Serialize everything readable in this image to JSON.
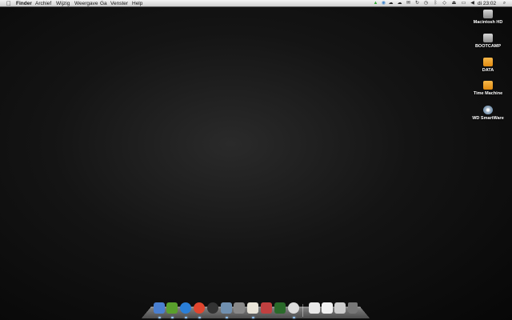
{
  "menubar": {
    "items": [
      "Finder",
      "Archief",
      "Wijzig",
      "Weergave",
      "Ga",
      "Venster",
      "Help"
    ],
    "clock": "di 23:02",
    "status_icons": [
      "activity-icon",
      "network-icon",
      "cloud-icon",
      "cloud2-icon",
      "mail-icon",
      "sync-icon",
      "time-machine-icon",
      "bluetooth-icon",
      "wifi-icon",
      "eject-icon",
      "battery-icon",
      "volume-icon",
      "spotlight-icon"
    ]
  },
  "desktop": {
    "icons": [
      {
        "label": "Macintosh HD",
        "type": "hd"
      },
      {
        "label": "BOOTCAMP",
        "type": "hd"
      },
      {
        "label": "DATA",
        "type": "ext"
      },
      {
        "label": "Time Machine",
        "type": "ext"
      },
      {
        "label": "WD SmartWare",
        "type": "cd"
      }
    ]
  },
  "dock": {
    "apps": [
      {
        "name": "finder",
        "color": "#4a7fd0",
        "running": true
      },
      {
        "name": "android-app",
        "color": "#5aa02c",
        "running": true
      },
      {
        "name": "itunes",
        "color": "#2a7fd8",
        "running": true
      },
      {
        "name": "chrome",
        "color": "#e0452e",
        "running": true
      },
      {
        "name": "dashboard",
        "color": "#333333",
        "running": false
      },
      {
        "name": "iphoto",
        "color": "#7090b0",
        "running": true
      },
      {
        "name": "system-preferences",
        "color": "#888888",
        "running": false
      },
      {
        "name": "textedit",
        "color": "#e8e4d8",
        "running": true
      },
      {
        "name": "script-editor",
        "color": "#c04040",
        "running": false
      },
      {
        "name": "activity-monitor",
        "color": "#2a6a2a",
        "running": false
      },
      {
        "name": "cloud-app",
        "color": "#dddddd",
        "running": true
      }
    ],
    "stacks": [
      {
        "name": "documents-stack",
        "color": "#e8e8e8"
      },
      {
        "name": "downloads-stack",
        "color": "#f0f0f0"
      },
      {
        "name": "chrome-stack",
        "color": "#cccccc"
      },
      {
        "name": "trash",
        "color": "#777777"
      }
    ]
  }
}
